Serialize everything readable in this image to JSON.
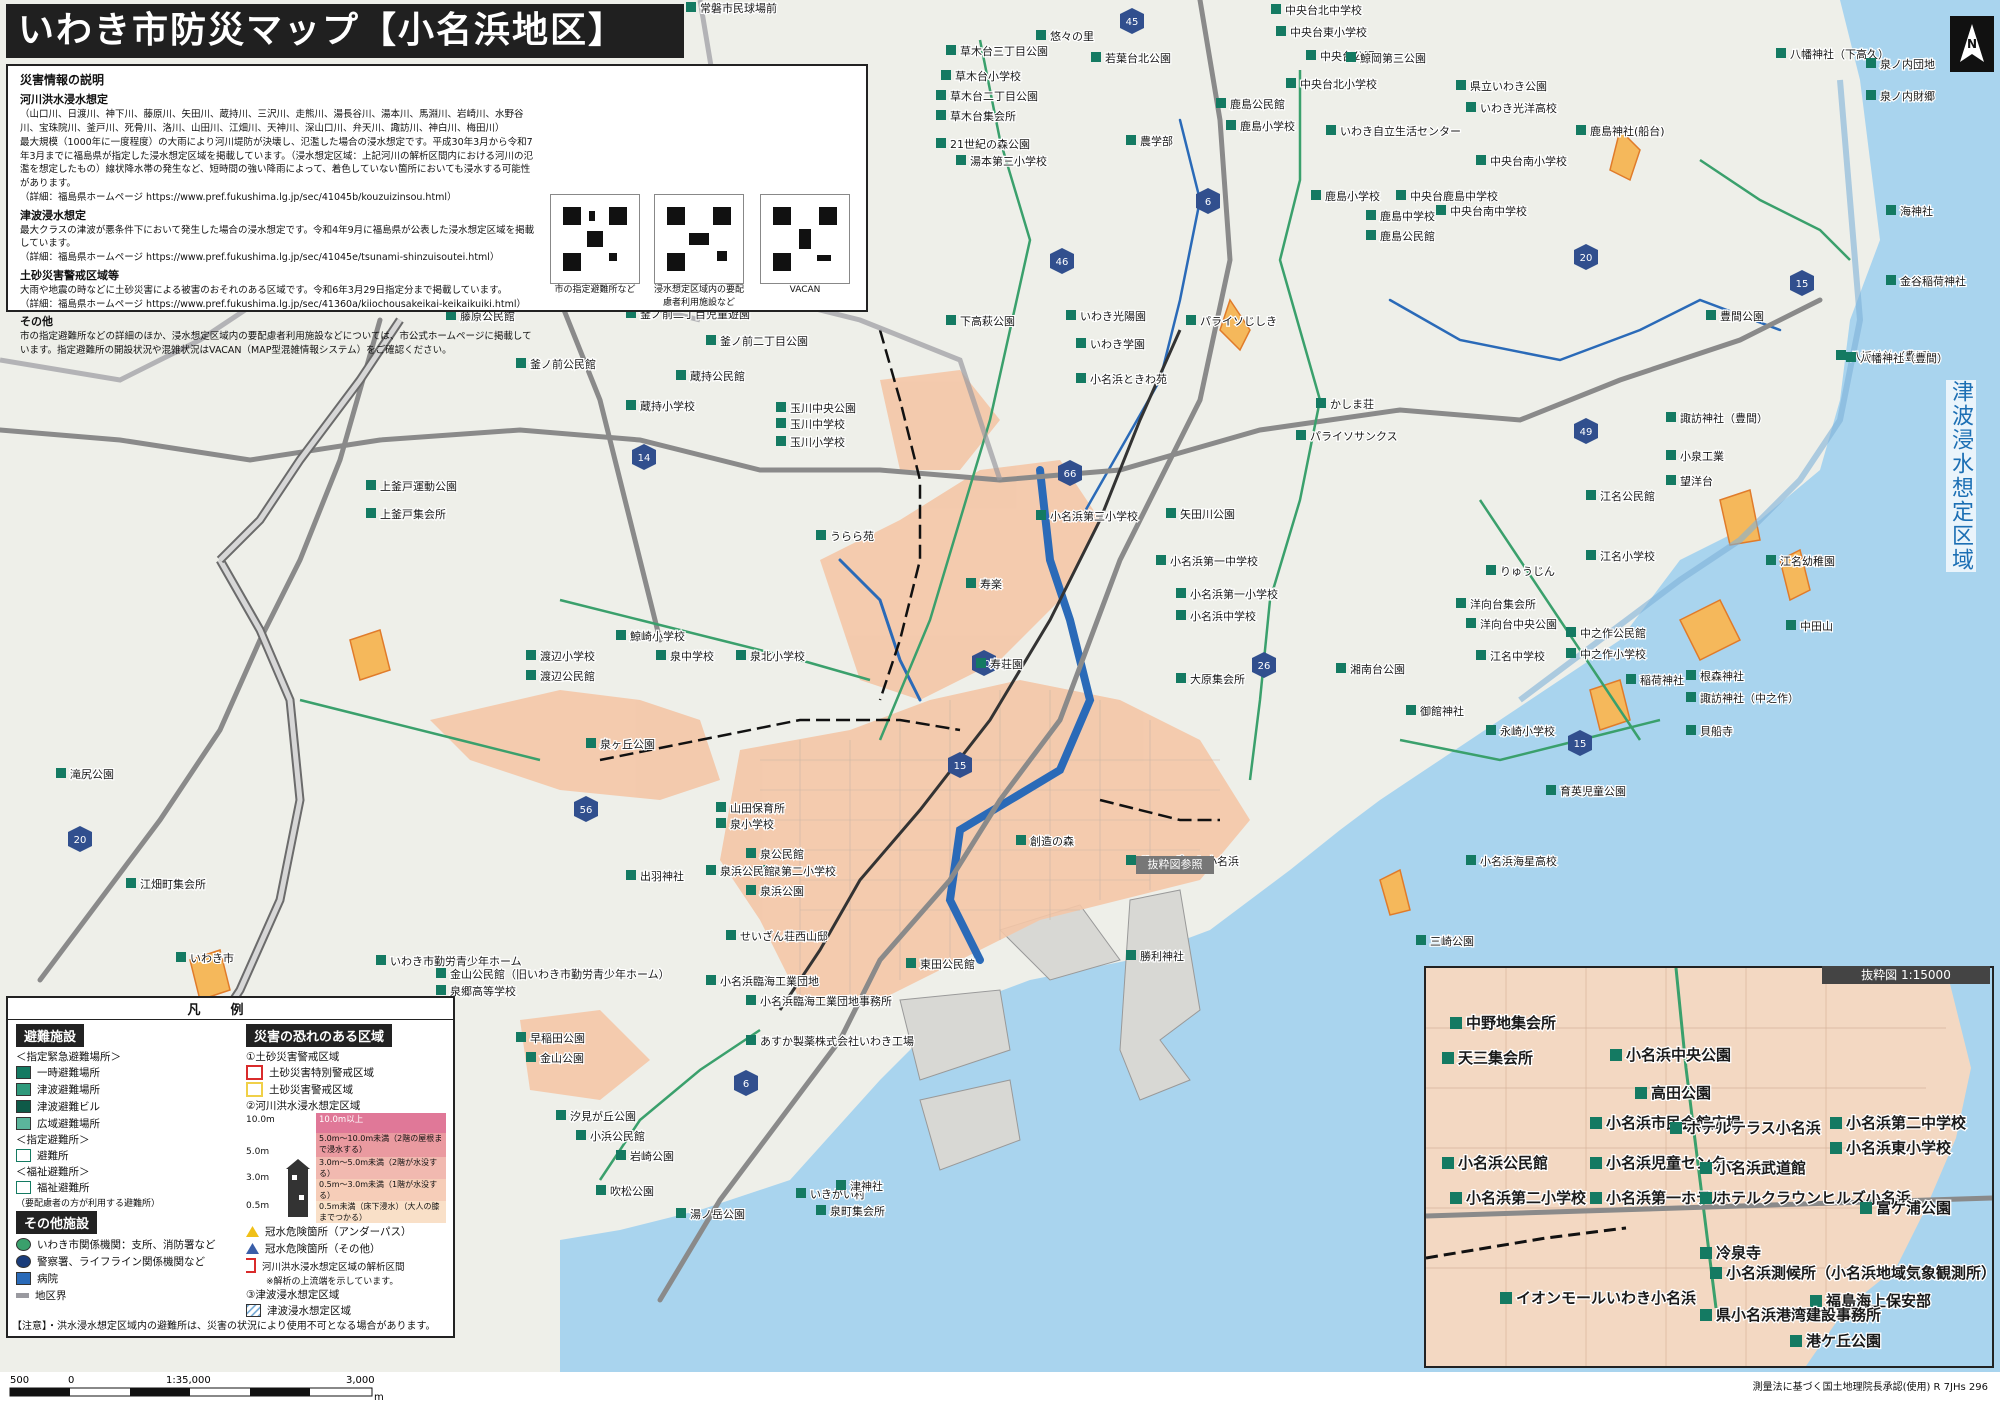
{
  "title": "いわき市防災マップ【小名浜地区】",
  "info": {
    "heading": "災害情報の説明",
    "flood_title": "河川洪水浸水想定",
    "flood_rivers": "（山口川、日渡川、神下川、藤原川、矢田川、蔵持川、三沢川、走熊川、湯長谷川、湯本川、馬淵川、岩崎川、水野谷川、宝珠院川、釜戸川、死骨川、洛川、山田川、江畑川、天神川、深山口川、弁天川、諏訪川、神白川、梅田川）",
    "flood_desc": "最大規模（1000年に一度程度）の大雨により河川堤防が決壊し、氾濫した場合の浸水想定です。平成30年3月から令和7年3月までに福島県が指定した浸水想定区域を掲載しています。（浸水想定区域：上記河川の解析区間内における河川の氾濫を想定したもの）線状降水帯の発生など、短時間の強い降雨によって、着色していない箇所においても浸水する可能性があります。",
    "flood_url": "（詳細：福島県ホームページ https://www.pref.fukushima.lg.jp/sec/41045b/kouzuizinsou.html）",
    "tsunami_title": "津波浸水想定",
    "tsunami_desc": "最大クラスの津波が悪条件下において発生した場合の浸水想定です。令和4年9月に福島県が公表した浸水想定区域を掲載しています。",
    "tsunami_url": "（詳細：福島県ホームページ https://www.pref.fukushima.lg.jp/sec/41045e/tsunami-shinzuisoutei.html）",
    "landslide_title": "土砂災害警戒区域等",
    "landslide_desc": "大雨や地震の時などに土砂災害による被害のおそれのある区域です。令和6年3月29日指定分まで掲載しています。",
    "landslide_url": "（詳細：福島県ホームページ https://www.pref.fukushima.lg.jp/sec/41360a/kiiochousakeikai-keikaikuiki.html）",
    "other_title": "その他",
    "other_desc": "市の指定避難所などの詳細のほか、浸水想定区域内の要配慮者利用施設などについては、市公式ホームページに掲載しています。指定避難所の開設状況や混雑状況はVACAN（MAP型混雑情報システム）をご確認ください。",
    "qr_labels": [
      "市の指定避難所など",
      "浸水想定区域内の要配慮者利用施設など",
      "VACAN"
    ]
  },
  "map_labels": [
    "常磐市民球場前",
    "中央台北中学校",
    "中央台公園",
    "中央台東小学校",
    "八幡神社（下高久）",
    "泉ノ内団地",
    "泉ノ内財郷",
    "草木台三丁目公園",
    "悠々の里",
    "若葉台北公園",
    "中央台北小学校",
    "鯨岡第三公園",
    "草木台小学校",
    "草木台二丁目公園",
    "草木台集会所",
    "鹿島公民館",
    "鹿島小学校",
    "いわき光洋高校",
    "県立いわき公園",
    "いわき自立生活センター",
    "中央台南小学校",
    "湯本第三小学校",
    "農学部",
    "21世紀の森公園",
    "中央台南中学校",
    "中央台鹿島中学校",
    "鹿島小学校",
    "鹿島中学校",
    "鹿島公民館",
    "鹿島神社(船台)",
    "海神社",
    "金谷稲荷神社",
    "豊間公園",
    "八坂神社（豊間）",
    "八幡神社（豊間）",
    "諏訪神社（豊間）",
    "小泉工業",
    "望洋台",
    "江名公民館",
    "江名小学校",
    "江名幼稚園",
    "りゅうじん",
    "洋向台集会所",
    "洋向台中央公園",
    "中之作公民館",
    "中之作小学校",
    "中田山",
    "江名中学校",
    "稲荷神社",
    "根森神社",
    "諏訪神社（中之作）",
    "貝船寺",
    "永崎小学校",
    "御館神社",
    "育英児童公園",
    "小名浜海星高校",
    "三崎公園",
    "藤原公民館",
    "釜ノ前二丁目児童遊園",
    "下高萩公園",
    "いわき光陽園",
    "いわき学園",
    "パライソじしき",
    "釜ノ前公民館",
    "釜ノ前二丁目公園",
    "蔵持公民館",
    "蔵持小学校",
    "小名浜ときわ苑",
    "かしま荘",
    "玉川中央公園",
    "玉川中学校",
    "玉川小学校",
    "パライソサンクス",
    "矢田川公園",
    "上釜戸運動公園",
    "上釜戸集会所",
    "小名浜第三小学校",
    "うらら苑",
    "寿楽",
    "寿荘園",
    "鯨崎小学校",
    "小名浜第一中学校",
    "小名浜第一小学校",
    "小名浜中学校",
    "湘南台公園",
    "大原集会所",
    "渡辺小学校",
    "渡辺公民館",
    "泉北小学校",
    "泉中学校",
    "泉ヶ丘公園",
    "滝尻公園",
    "山田保育所",
    "泉小学校",
    "泉公民館",
    "泉第二小学校",
    "泉浜公園",
    "泉浜公民館",
    "創造の森",
    "サニーポート小名浜",
    "抜粋図参照",
    "江畑町集会所",
    "せいざん荘西山邸",
    "出羽神社",
    "いわき市",
    "泉郷高等学校",
    "いわき市勤労青少年ホーム",
    "金山公民館（旧いわき市勤労青少年ホーム）",
    "小名浜臨海工業団地",
    "小名浜臨海工業団地事務所",
    "あすか製薬株式会社いわき工場",
    "早稲田公園",
    "金山公園",
    "東田公民館",
    "汐見が丘公園",
    "小浜公民館",
    "岩崎公園",
    "吹松公園",
    "いきがい村",
    "勝利神社",
    "津神社",
    "泉町集会所",
    "湯ノ岳公園"
  ],
  "route_numbers": [
    "45",
    "6",
    "6",
    "49",
    "14",
    "15",
    "15",
    "20",
    "20",
    "26",
    "56",
    "66",
    "46",
    "15",
    "20"
  ],
  "tsunami_zone_label": "津波浸水想定区域",
  "legend": {
    "title": "凡例",
    "shelter_head": "避難施設",
    "shelter_sub1": "＜指定緊急避難場所＞",
    "shelter_items": [
      "一時避難場所",
      "津波避難場所",
      "津波避難ビル",
      "広域避難場所"
    ],
    "shelter_sub2": "＜指定避難所＞",
    "shelter_items2": [
      "避難所"
    ],
    "shelter_sub3": "＜福祉避難所＞",
    "shelter_items3": [
      "福祉避難所",
      "（要配慮者の方が利用する避難所）"
    ],
    "other_head": "その他施設",
    "other_items": [
      "いわき市関係機関：支所、消防署など",
      "警察署、ライフライン関係機関など",
      "病院",
      "地区界"
    ],
    "hazard_head": "災害の恐れのある区域",
    "landslide_head": "①土砂災害警戒区域",
    "landslide_items": [
      "土砂災害特別警戒区域",
      "土砂災害警戒区域"
    ],
    "flood_head": "②河川洪水浸水想定区域",
    "flood_depths": [
      "10.0m以上",
      "5.0m～10.0m未満（2階の屋根まで浸水する）",
      "3.0m～5.0m未満（2階が水没する）",
      "0.5m～3.0m未満（1階が水没する）",
      "0.5m未満（床下浸水）（大人の膝までつかる）"
    ],
    "flood_scale": [
      "10.0m",
      "5.0m",
      "3.0m",
      "0.5m"
    ],
    "flood_extra": [
      "冠水危険箇所（アンダーパス）",
      "冠水危険箇所（その他）",
      "河川洪水浸水想定区域の解析区間",
      "※解析の上流端を示しています。"
    ],
    "tsunami_head": "③津波浸水想定区域",
    "tsunami_item": "津波浸水想定区域",
    "note": "【注意】・洪水浸水想定区域内の避難所は、災害の状況により使用不可となる場合があります。"
  },
  "inset": {
    "title": "抜粋図 1:15000",
    "labels": [
      "中野地集会所",
      "天三集会所",
      "小名浜中央公園",
      "高田公園",
      "小名浜第二中学校",
      "小名浜市民会館広場",
      "ホテルテラス小名浜",
      "小名浜東小学校",
      "小名浜公民館",
      "小名浜児童センター",
      "小名浜武道館",
      "小名浜第二小学校",
      "小名浜第一ホテル",
      "ホテルクラウンヒルズ小名浜",
      "富ケ浦公園",
      "冷泉寺",
      "小名浜測候所（小名浜地域気象観測所）",
      "イオンモールいわき小名浜",
      "福島海上保安部",
      "県小名浜港湾建設事務所",
      "港ケ丘公園"
    ]
  },
  "footer": {
    "scale_text": "1:35,000",
    "scale_marks": [
      "500",
      "0",
      "3,000"
    ],
    "scale_unit": "m",
    "approval": "測量法に基づく国土地理院長承認(使用) R 7JHs 296"
  },
  "colors": {
    "land": "#efefea",
    "sea": "#a9d4ee",
    "flood": "#f4c6a7",
    "landslide": "#f5b85b",
    "road_national": "#7f7f7f",
    "prefecture_road": "#3aa06c",
    "river": "#2a6ab8",
    "shelter": "#147a62"
  }
}
